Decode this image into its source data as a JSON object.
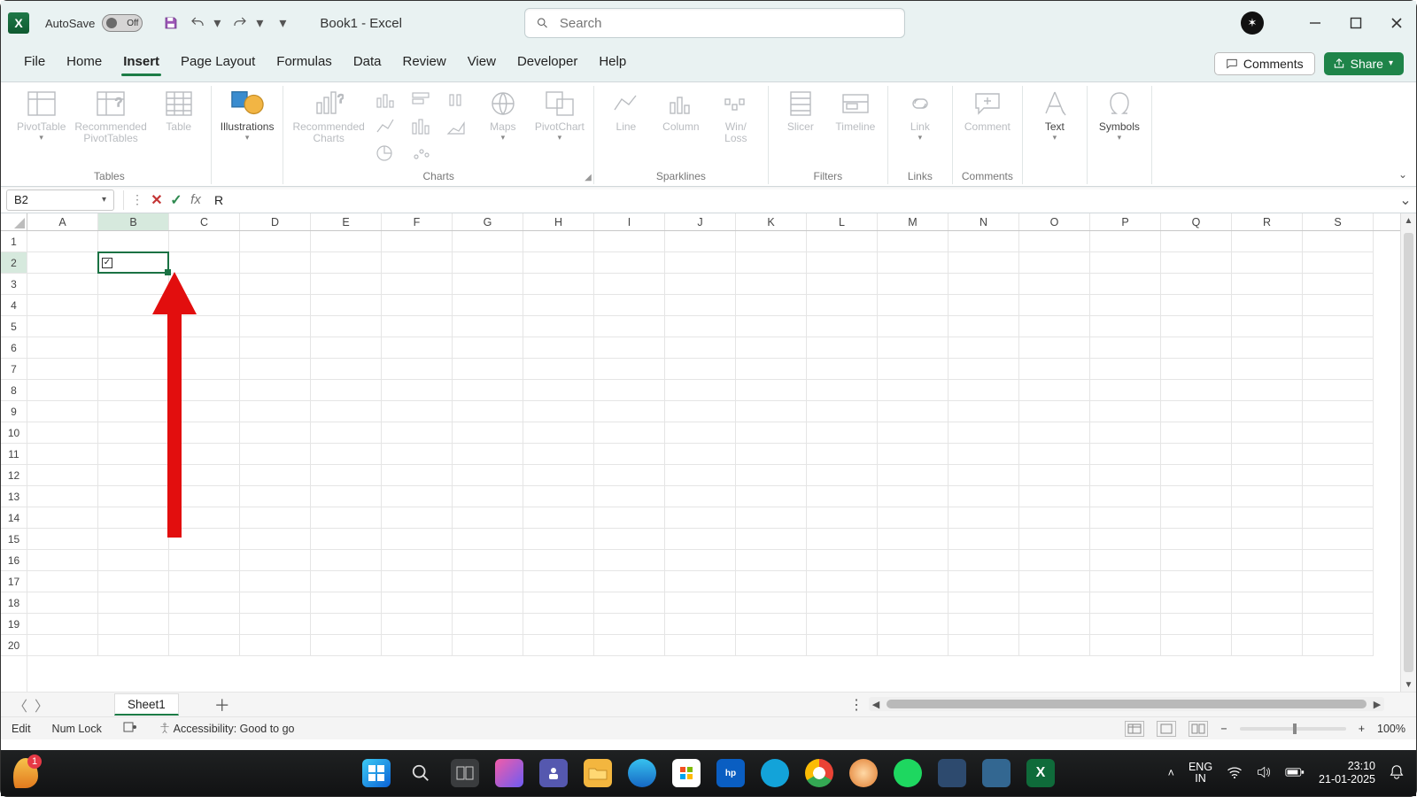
{
  "titlebar": {
    "autosave_label": "AutoSave",
    "autosave_state": "Off",
    "document": "Book1  -  Excel"
  },
  "search": {
    "placeholder": "Search"
  },
  "window": {
    "account_initial": "✶"
  },
  "tabs": {
    "items": [
      "File",
      "Home",
      "Insert",
      "Page Layout",
      "Formulas",
      "Data",
      "Review",
      "View",
      "Developer",
      "Help"
    ],
    "active": "Insert",
    "comments": "Comments",
    "share": "Share"
  },
  "ribbon": {
    "tables": {
      "label": "Tables",
      "pivot": "PivotTable",
      "recpivot": "Recommended\nPivotTables",
      "table": "Table"
    },
    "illus": {
      "label": "Illustrations"
    },
    "charts": {
      "label": "Charts",
      "rec": "Recommended\nCharts",
      "maps": "Maps",
      "pivotchart": "PivotChart"
    },
    "spark": {
      "label": "Sparklines",
      "line": "Line",
      "column": "Column",
      "winloss": "Win/\nLoss"
    },
    "filters": {
      "label": "Filters",
      "slicer": "Slicer",
      "timeline": "Timeline"
    },
    "links": {
      "label": "Links",
      "link": "Link"
    },
    "comments": {
      "label": "Comments",
      "comment": "Comment"
    },
    "text": {
      "label": "Text"
    },
    "symbols": {
      "label": "Symbols"
    }
  },
  "formula_bar": {
    "name": "B2",
    "value": "R"
  },
  "grid": {
    "columns": [
      "A",
      "B",
      "C",
      "D",
      "E",
      "F",
      "G",
      "H",
      "I",
      "J",
      "K",
      "L",
      "M",
      "N",
      "O",
      "P",
      "Q",
      "R",
      "S"
    ],
    "rows": [
      "1",
      "2",
      "3",
      "4",
      "5",
      "6",
      "7",
      "8",
      "9",
      "10",
      "11",
      "12",
      "13",
      "14",
      "15",
      "16",
      "17",
      "18",
      "19",
      "20"
    ],
    "active": {
      "col": "B",
      "row": "2",
      "display": "☑"
    }
  },
  "sheets": {
    "active": "Sheet1"
  },
  "status": {
    "mode": "Edit",
    "numlock": "Num Lock",
    "accessibility": "Accessibility: Good to go",
    "zoom": "100%"
  },
  "taskbar": {
    "lang1": "ENG",
    "lang2": "IN",
    "time": "23:10",
    "date": "21-01-2025",
    "badge": "1"
  }
}
